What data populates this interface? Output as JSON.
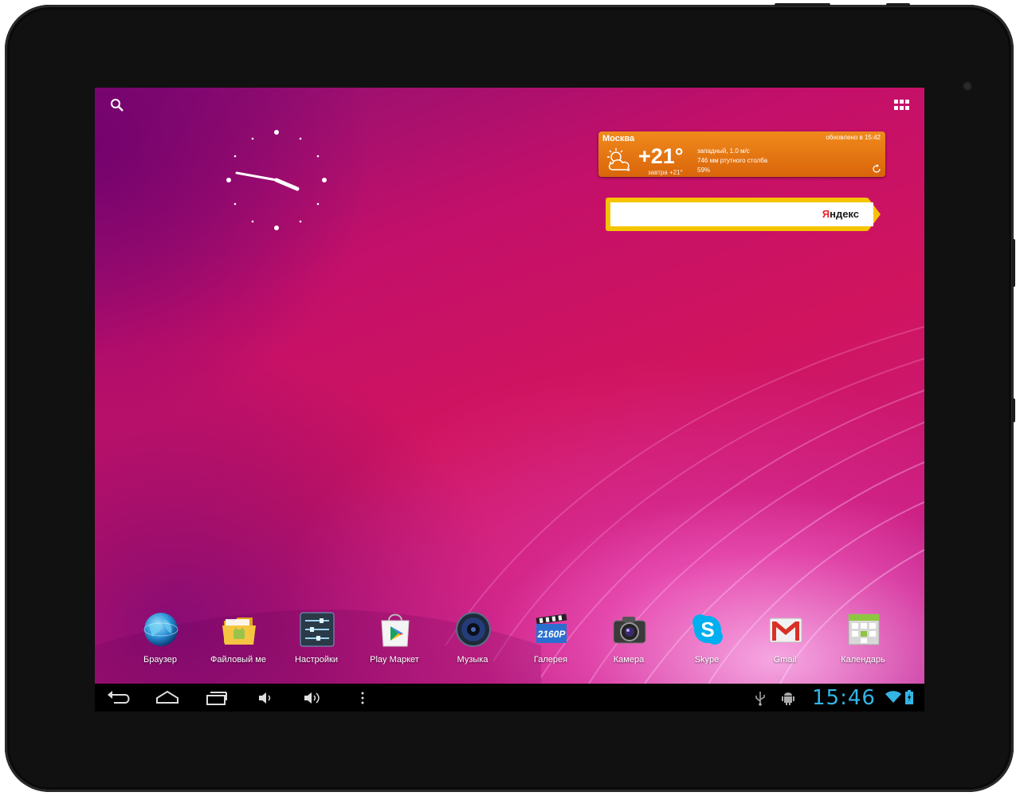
{
  "weather": {
    "city": "Москва",
    "updated": "обновлено в 15:42",
    "temperature": "+21°",
    "tomorrow": "завтра +21°",
    "wind": "западный, 1.0 м/с",
    "pressure": "746 мм ртутного столба",
    "humidity": "59%",
    "icon": "partly-cloudy-icon"
  },
  "yandex": {
    "logo_first": "Я",
    "logo_rest": "ндекс",
    "placeholder": ""
  },
  "dock": {
    "apps": [
      {
        "label": "Браузер",
        "icon": "globe-icon"
      },
      {
        "label": "Файловый ме",
        "icon": "file-manager-icon"
      },
      {
        "label": "Настройки",
        "icon": "settings-icon"
      },
      {
        "label": "Play Маркет",
        "icon": "play-store-icon"
      },
      {
        "label": "Музыка",
        "icon": "music-icon"
      },
      {
        "label": "Галерея",
        "icon": "gallery-icon"
      },
      {
        "label": "Камера",
        "icon": "camera-icon"
      },
      {
        "label": "Skype",
        "icon": "skype-icon"
      },
      {
        "label": "Gmail",
        "icon": "gmail-icon"
      },
      {
        "label": "Календарь",
        "icon": "calendar-icon"
      }
    ]
  },
  "statusbar": {
    "time": "15:46",
    "accent": "#33b5e5"
  },
  "colors": {
    "weather_bg": "#e8780f",
    "yandex_yellow": "#f5c400",
    "navbar_bg": "#000000"
  }
}
